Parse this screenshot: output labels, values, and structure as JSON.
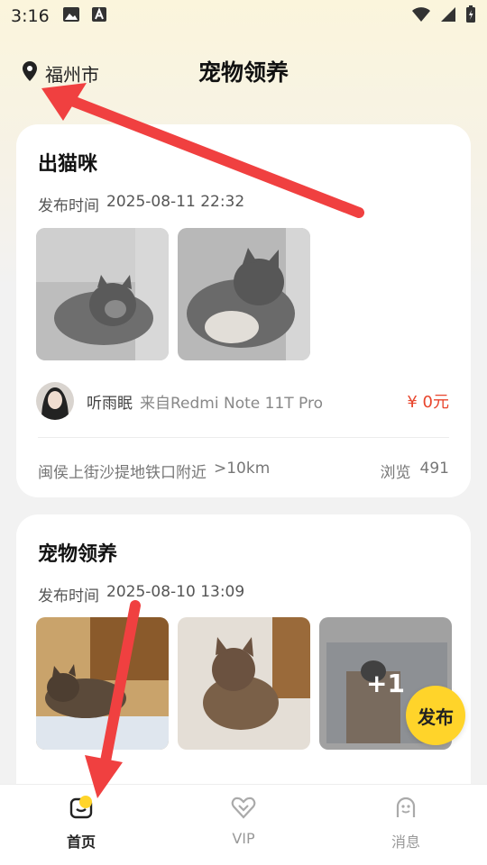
{
  "status": {
    "time": "3:16"
  },
  "header": {
    "location": "福州市",
    "title": "宠物领养"
  },
  "posts": [
    {
      "title": "出猫咪",
      "time_label": "发布时间",
      "time": "2025-08-11 22:32",
      "author": "听雨眠",
      "device": "来自Redmi Note 11T Pro",
      "price": "¥ 0元",
      "address": "闽侯上街沙提地铁口附近",
      "distance": ">10km",
      "views_label": "浏览",
      "views": "491"
    },
    {
      "title": "宠物领养",
      "time_label": "发布时间",
      "time": "2025-08-10 13:09",
      "more_count": "+1"
    }
  ],
  "fab": {
    "label": "发布"
  },
  "tabs": [
    {
      "label": "首页",
      "icon": "home-icon"
    },
    {
      "label": "VIP",
      "icon": "vip-heart-icon"
    },
    {
      "label": "消息",
      "icon": "message-icon"
    }
  ],
  "colors": {
    "accent": "#ffd42a",
    "price": "#e8452c",
    "annotation_arrow": "#f04040"
  }
}
